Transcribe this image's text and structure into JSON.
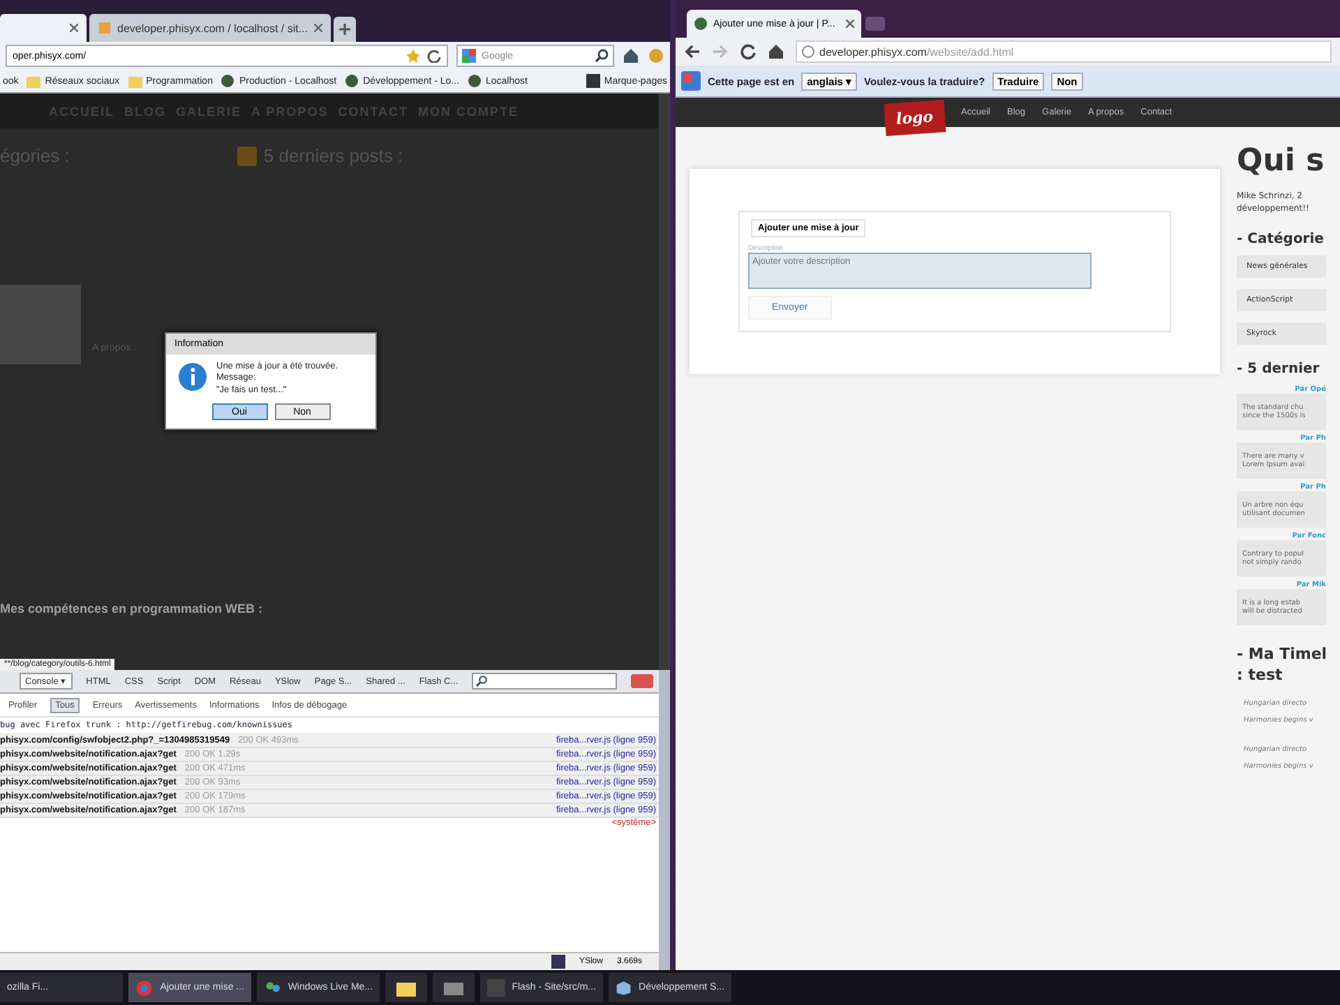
{
  "left_browser": {
    "tabs": [
      {
        "selected": true
      },
      {
        "label": "developer.phisyx.com / localhost / sit...",
        "selected": false
      }
    ],
    "address": "oper.phisyx.com/",
    "search_placeholder": "Google",
    "bookmarks": [
      {
        "label": "ook",
        "kind": "plain"
      },
      {
        "label": "Réseaux sociaux",
        "kind": "folder"
      },
      {
        "label": "Programmation",
        "kind": "folder"
      },
      {
        "label": "Production - Localhost",
        "kind": "site"
      },
      {
        "label": "Développement - Lo...",
        "kind": "site"
      },
      {
        "label": "Localhost",
        "kind": "site"
      },
      {
        "label": "Marque-pages",
        "kind": "menu"
      }
    ],
    "site_nav": [
      "ACCUEIL",
      "BLOG",
      "GALERIE",
      "A PROPOS",
      "CONTACT",
      "MON COMPTE"
    ],
    "categories_heading": "égories :",
    "posts_heading": "5 derniers posts :",
    "about_label": "A propos :",
    "skills_heading": "Mes compétences en programmation WEB :",
    "dialog": {
      "title": "Information",
      "lines": [
        "Une mise à jour a été trouvée.",
        "Message:",
        "\"Je fais un test...\""
      ],
      "buttons": [
        {
          "label": "Oui",
          "selected": true
        },
        {
          "label": "Non",
          "selected": false
        }
      ]
    },
    "status_url": "**/blog/category/outils-6.html",
    "firebug": {
      "panels": [
        {
          "label": "Console ▾",
          "selected": true
        },
        {
          "label": "HTML",
          "selected": false
        },
        {
          "label": "CSS",
          "selected": false
        },
        {
          "label": "Script",
          "selected": false
        },
        {
          "label": "DOM",
          "selected": false
        },
        {
          "label": "Réseau",
          "selected": false
        },
        {
          "label": "YSlow",
          "selected": false
        },
        {
          "label": "Page S...",
          "selected": false
        },
        {
          "label": "Shared ...",
          "selected": false
        },
        {
          "label": "Flash C...",
          "selected": false
        }
      ],
      "filters": [
        {
          "label": "Profiler",
          "selected": false
        },
        {
          "label": "Tous",
          "selected": true
        },
        {
          "label": "Erreurs",
          "selected": false
        },
        {
          "label": "Avertissements",
          "selected": false
        },
        {
          "label": "Informations",
          "selected": false
        },
        {
          "label": "Infos de débogage",
          "selected": false
        }
      ],
      "log": [
        {
          "kind": "message",
          "text": "bug avec Firefox trunk : http://getfirebug.com/knownissues"
        },
        {
          "kind": "request",
          "url": "phisyx.com/config/swfobject2.php?_=1304985319549",
          "status": "200 OK 493ms",
          "source": "fireba...rver.js (ligne 959)"
        },
        {
          "kind": "request",
          "url": "phisyx.com/website/notification.ajax?get",
          "status": "200 OK 1.29s",
          "source": "fireba...rver.js (ligne 959)"
        },
        {
          "kind": "request",
          "url": "phisyx.com/website/notification.ajax?get",
          "status": "200 OK 471ms",
          "source": "fireba...rver.js (ligne 959)"
        },
        {
          "kind": "request",
          "url": "phisyx.com/website/notification.ajax?get",
          "status": "200 OK 93ms",
          "source": "fireba...rver.js (ligne 959)"
        },
        {
          "kind": "request",
          "url": "phisyx.com/website/notification.ajax?get",
          "status": "200 OK 179ms",
          "source": "fireba...rver.js (ligne 959)"
        },
        {
          "kind": "request",
          "url": "phisyx.com/website/notification.ajax?get",
          "status": "200 OK 187ms",
          "source": "fireba...rver.js (ligne 959)"
        },
        {
          "kind": "system",
          "text": "<système>"
        }
      ],
      "status": {
        "tool": "YSlow",
        "time": "3.669s"
      }
    }
  },
  "right_browser": {
    "tab": "Ajouter une mise à jour | P...",
    "address_host": "developer.phisyx.com",
    "address_path": "/website/add.html",
    "translate": {
      "prefix": "Cette page est en",
      "language": "anglais ▾",
      "question": "Voulez-vous la traduire?",
      "buttons": [
        "Traduire",
        "Non"
      ]
    },
    "logo": "logo",
    "site_nav": [
      "Accueil",
      "Blog",
      "Galerie",
      "A propos",
      "Contact"
    ],
    "form": {
      "legend": "Ajouter une mise à jour",
      "label": "Description",
      "placeholder": "Ajouter votre description",
      "button": "Envoyer"
    },
    "sidebar": {
      "title": "Qui s",
      "intro": [
        "Mike Schrinzi, 2",
        "développement!!"
      ],
      "categories_heading": "- Catégorie",
      "categories": [
        "News générales",
        "ActionScript",
        "Skyrock"
      ],
      "posts_heading": "- 5 dernier",
      "posts": [
        {
          "author": "Par Opé",
          "lines": [
            "The standard chu",
            "since the 1500s is"
          ]
        },
        {
          "author": "Par Ph",
          "lines": [
            "There are many v",
            "Lorem Ipsum avai"
          ]
        },
        {
          "author": "Par Ph",
          "lines": [
            "Un arbre non équ",
            "utilisant documen"
          ]
        },
        {
          "author": "Par Fonc",
          "lines": [
            "Contrary to popul",
            "not simply rando"
          ]
        },
        {
          "author": "Par Mik",
          "lines": [
            "It is a long estab",
            "will be distracted"
          ]
        }
      ],
      "timeline_heading": [
        "- Ma Timel",
        ": test"
      ],
      "timeline": [
        [
          "Hungarian directo",
          "Harmonies begins v"
        ],
        [
          "Hungarian directo",
          "Harmonies begins v"
        ]
      ]
    }
  },
  "taskbar": [
    {
      "label": "ozilla Fi...",
      "kind": "plain",
      "selected": false
    },
    {
      "label": "Ajouter une mise ...",
      "kind": "browser",
      "selected": true
    },
    {
      "label": "Windows Live Me...",
      "kind": "people",
      "selected": false
    },
    {
      "kind": "folder",
      "selected": false
    },
    {
      "kind": "media",
      "selected": false
    },
    {
      "label": "Flash - Site/src/m...",
      "kind": "flash",
      "selected": false
    },
    {
      "label": "Développement S...",
      "kind": "cube",
      "selected": false
    }
  ]
}
